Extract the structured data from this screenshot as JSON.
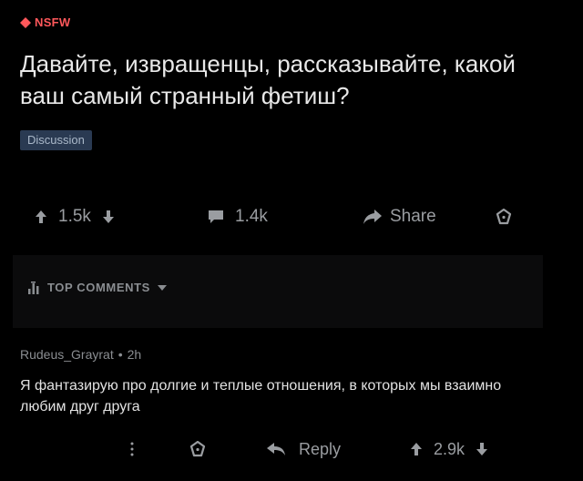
{
  "post": {
    "nsfw_label": "NSFW",
    "title": "Давайте, извращенцы, рассказывайте, какой ваш самый странный фетиш?",
    "flair": "Discussion"
  },
  "actions": {
    "upvotes": "1.5k",
    "comments": "1.4k",
    "share_label": "Share"
  },
  "comments_section": {
    "sort_label": "TOP COMMENTS"
  },
  "top_comment": {
    "author": "Rudeus_Grayrat",
    "separator": "•",
    "age": "2h",
    "text": "Я фантазирую про долгие и теплые отношения, в которых мы взаимно любим друг друга",
    "reply_label": "Reply",
    "score": "2.9k"
  },
  "icons": {
    "nsfw": "nsfw-diamond-icon",
    "upvote": "arrow-up-icon",
    "downvote": "arrow-down-icon",
    "comments": "speech-bubble-icon",
    "share": "share-arrow-icon",
    "award": "award-icon",
    "sort": "sort-bars-icon",
    "sort_dropdown": "chevron-down-icon",
    "more": "more-vertical-icon",
    "reply": "reply-arrow-icon"
  },
  "colors": {
    "background": "#000000",
    "nsfw": "#ff585b",
    "flair_bg": "#2a3a52",
    "text": "#e8e8e8",
    "muted": "#9a9da1"
  }
}
